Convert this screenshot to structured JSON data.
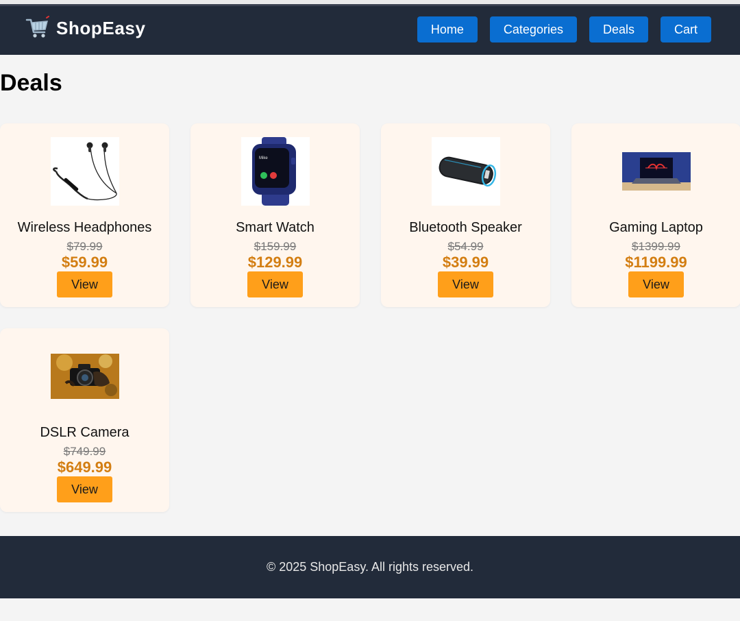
{
  "header": {
    "brand": "ShopEasy",
    "nav": [
      "Home",
      "Categories",
      "Deals",
      "Cart"
    ]
  },
  "page": {
    "title": "Deals"
  },
  "products": [
    {
      "name": "Wireless Headphones",
      "old_price": "$79.99",
      "price": "$59.99",
      "button": "View",
      "icon": "headphones-image"
    },
    {
      "name": "Smart Watch",
      "old_price": "$159.99",
      "price": "$129.99",
      "button": "View",
      "icon": "smartwatch-image"
    },
    {
      "name": "Bluetooth Speaker",
      "old_price": "$54.99",
      "price": "$39.99",
      "button": "View",
      "icon": "speaker-image"
    },
    {
      "name": "Gaming Laptop",
      "old_price": "$1399.99",
      "price": "$1199.99",
      "button": "View",
      "icon": "laptop-image"
    },
    {
      "name": "DSLR Camera",
      "old_price": "$749.99",
      "price": "$649.99",
      "button": "View",
      "icon": "camera-image"
    }
  ],
  "footer": {
    "text": "© 2025 ShopEasy. All rights reserved."
  },
  "colors": {
    "header_bg": "#222b3a",
    "nav_button": "#0a6ed1",
    "card_bg": "#fff6ee",
    "price": "#d37e12",
    "view_button": "#ff9f1a"
  }
}
